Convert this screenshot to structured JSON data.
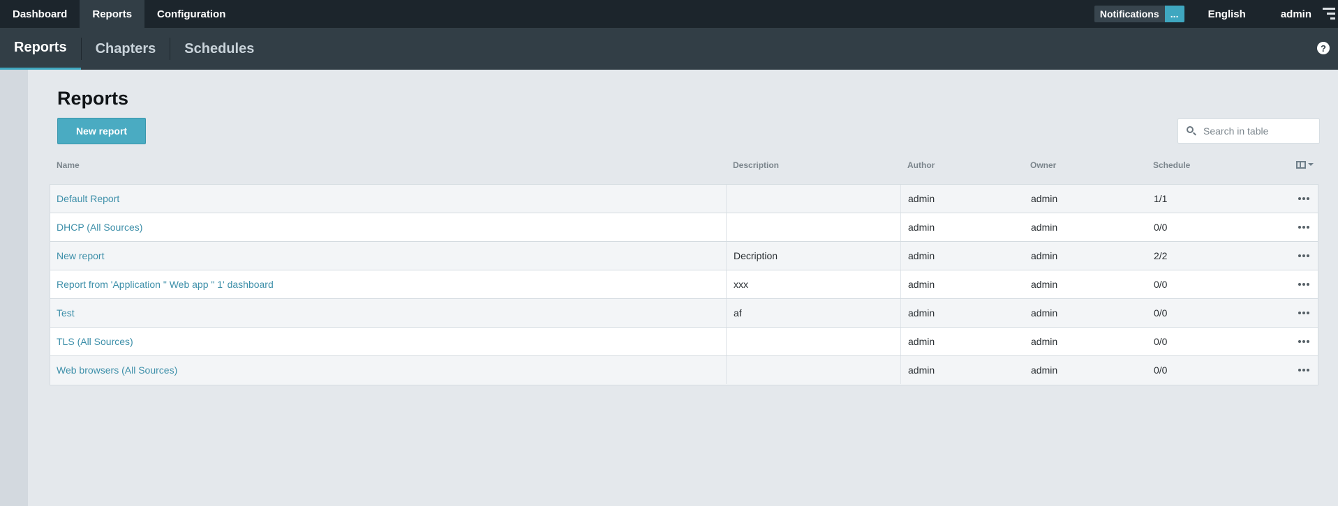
{
  "topnav": {
    "items": [
      {
        "label": "Dashboard",
        "active": false
      },
      {
        "label": "Reports",
        "active": true
      },
      {
        "label": "Configuration",
        "active": false
      }
    ],
    "notifications_label": "Notifications",
    "notifications_badge": "...",
    "language": "English",
    "user": "admin"
  },
  "subnav": {
    "tabs": [
      {
        "label": "Reports",
        "active": true
      },
      {
        "label": "Chapters",
        "active": false
      },
      {
        "label": "Schedules",
        "active": false
      }
    ],
    "help_icon": "?"
  },
  "main": {
    "title": "Reports",
    "new_button_label": "New report",
    "search_placeholder": "Search in table"
  },
  "table": {
    "columns": [
      "Name",
      "Description",
      "Author",
      "Owner",
      "Schedule"
    ],
    "rows": [
      {
        "name": "Default Report",
        "description": "",
        "author": "admin",
        "owner": "admin",
        "schedule": "1/1"
      },
      {
        "name": "DHCP (All Sources)",
        "description": "",
        "author": "admin",
        "owner": "admin",
        "schedule": "0/0"
      },
      {
        "name": "New report",
        "description": "Decription",
        "author": "admin",
        "owner": "admin",
        "schedule": "2/2"
      },
      {
        "name": "Report from 'Application \" Web app \" 1' dashboard",
        "description": "xxx",
        "author": "admin",
        "owner": "admin",
        "schedule": "0/0"
      },
      {
        "name": "Test",
        "description": "af",
        "author": "admin",
        "owner": "admin",
        "schedule": "0/0"
      },
      {
        "name": "TLS (All Sources)",
        "description": "",
        "author": "admin",
        "owner": "admin",
        "schedule": "0/0"
      },
      {
        "name": "Web browsers (All Sources)",
        "description": "",
        "author": "admin",
        "owner": "admin",
        "schedule": "0/0"
      }
    ]
  },
  "colors": {
    "topbar_bg": "#1c252c",
    "subnav_bg": "#323e46",
    "accent": "#3fa7c0",
    "link": "#3d8fa9"
  }
}
